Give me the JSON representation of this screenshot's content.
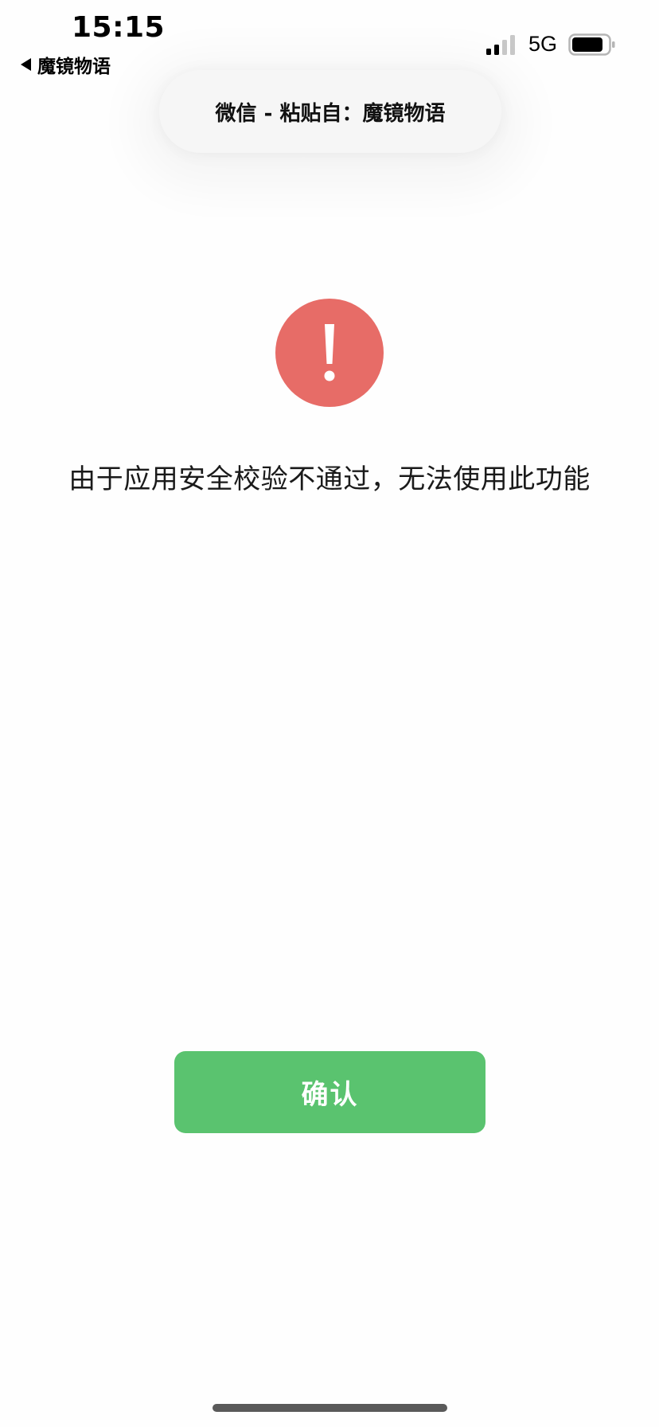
{
  "status_bar": {
    "time": "15:15",
    "back_app": "魔镜物语",
    "network": "5G",
    "signal_bars": 2,
    "signal_total": 4
  },
  "banner": {
    "text": "微信 - 粘贴自：魔镜物语"
  },
  "dialog": {
    "icon": "exclamation-icon",
    "message": "由于应用安全校验不通过，无法使用此功能",
    "confirm_label": "确认"
  },
  "colors": {
    "error_red": "#e76c67",
    "confirm_green": "#5ac36f"
  }
}
